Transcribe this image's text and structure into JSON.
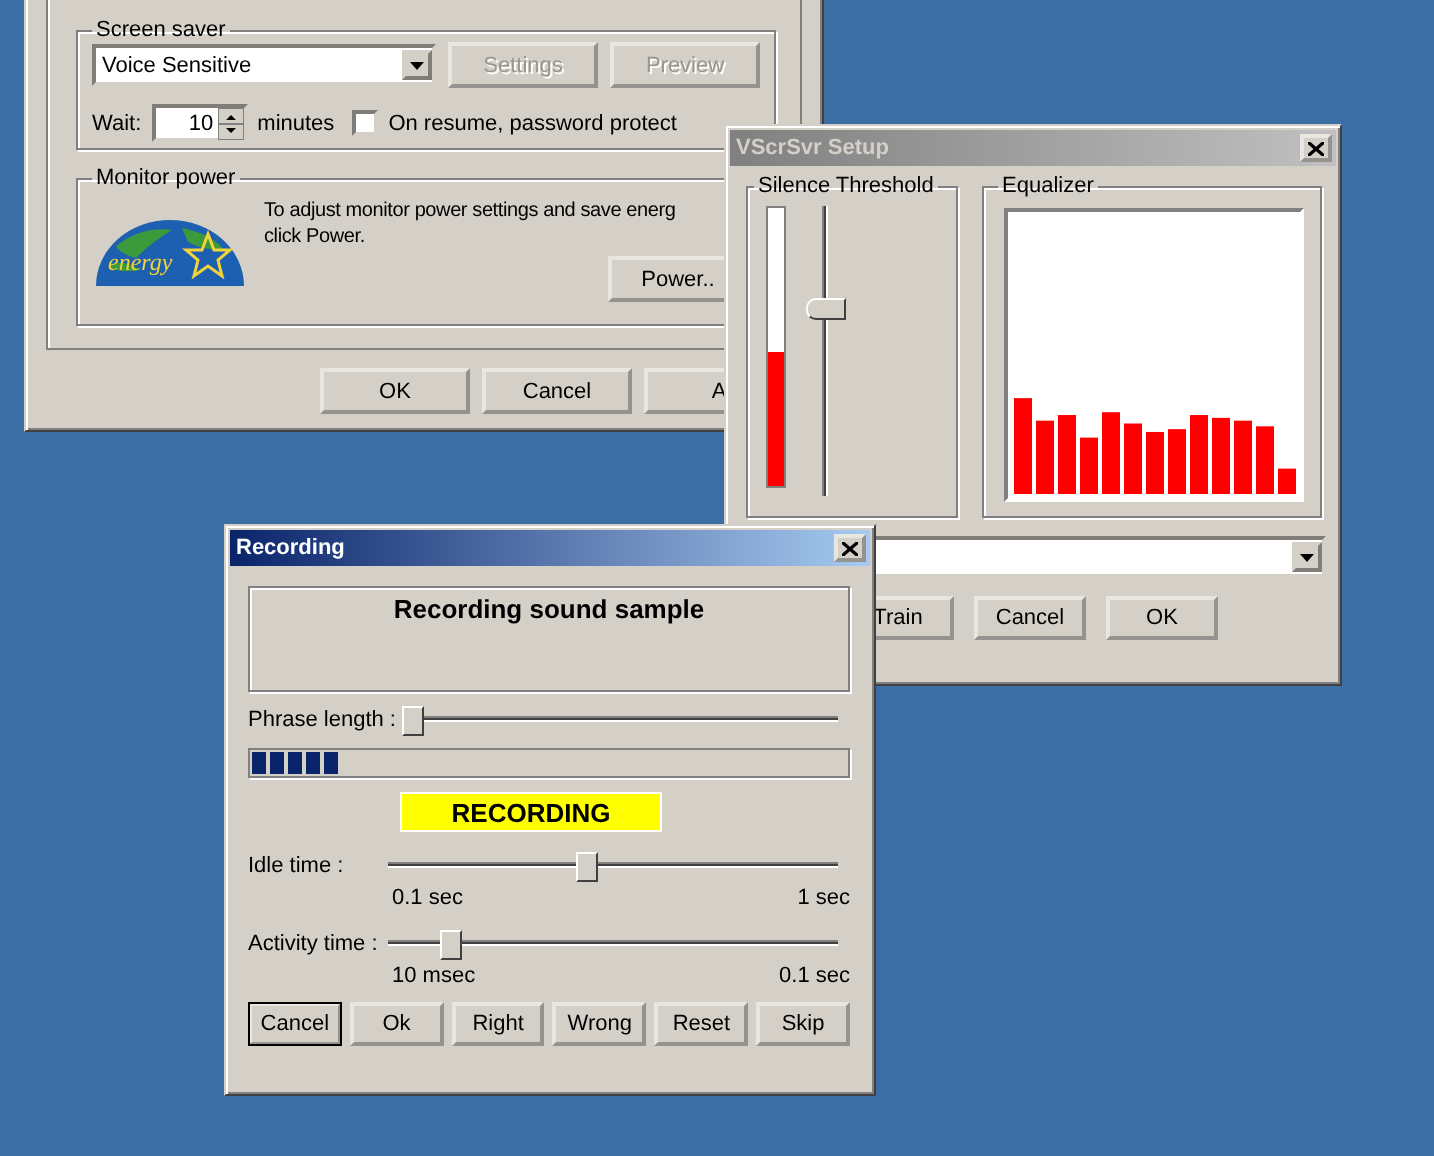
{
  "display_window": {
    "screen_saver": {
      "title": "Screen saver",
      "selected_saver": "Voice Sensitive",
      "buttons": [
        {
          "label": "Settings",
          "disabled": true
        },
        {
          "label": "Preview",
          "disabled": true
        }
      ],
      "wait_label": "Wait:",
      "wait_value": "10",
      "wait_unit": "minutes",
      "password_protect": {
        "label": "On resume, password protect",
        "checked": false
      }
    },
    "monitor_power": {
      "title": "Monitor power",
      "logo_text": "energy",
      "description_lines": [
        "To adjust monitor power settings and save energ",
        "click Power."
      ],
      "power_button": "Power.."
    },
    "buttons": [
      "OK",
      "Cancel",
      "A"
    ]
  },
  "setup_window": {
    "title": "VScrSvr Setup",
    "active": false,
    "silence_threshold": {
      "title": "Silence Threshold",
      "meter": {
        "level": 0.48
      },
      "slider": {
        "level": 0.66
      }
    },
    "equalizer": {
      "title": "Equalizer"
    },
    "buttons": [
      "Train",
      "Cancel",
      "OK"
    ]
  },
  "recording_window": {
    "title": "Recording",
    "active": true,
    "message": "Recording sound sample",
    "phrase_length": {
      "label": "Phrase length :",
      "level": 0
    },
    "progress": {
      "level": 0.15
    },
    "status": "RECORDING",
    "idle_time": {
      "label": "Idle time :",
      "level": 0.44,
      "min": "0.1 sec",
      "max": "1 sec"
    },
    "activity_time": {
      "label": "Activity time :",
      "level": 0.12,
      "min": "10 msec",
      "max": "0.1 sec"
    },
    "buttons": [
      {
        "label": "Cancel",
        "default": true
      },
      {
        "label": "Ok",
        "default": false
      },
      {
        "label": "Right",
        "default": false
      },
      {
        "label": "Wrong",
        "default": false
      },
      {
        "label": "Reset",
        "default": false
      },
      {
        "label": "Skip",
        "default": false
      }
    ]
  }
}
